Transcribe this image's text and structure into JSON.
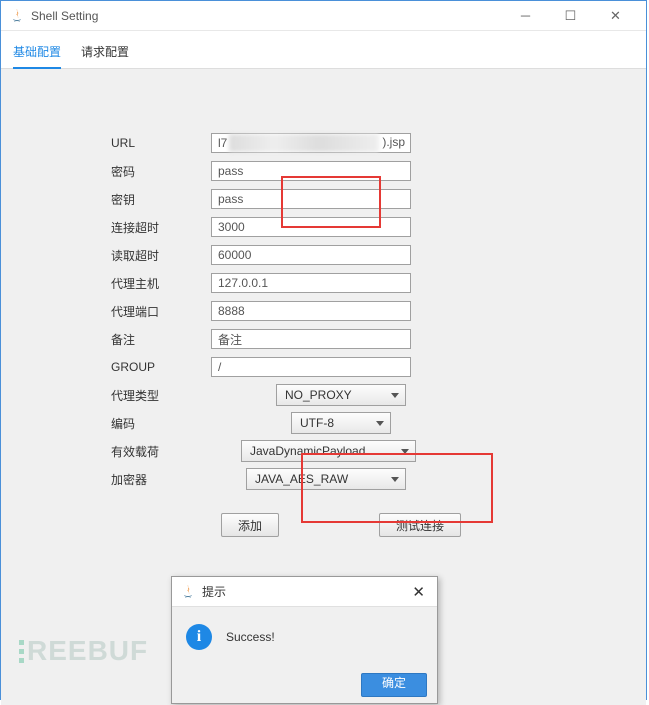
{
  "title": "Shell Setting",
  "tabs": {
    "basic": "基础配置",
    "request": "请求配置"
  },
  "labels": {
    "url": "URL",
    "password": "密码",
    "key": "密钥",
    "connTimeout": "连接超时",
    "readTimeout": "读取超时",
    "proxyHost": "代理主机",
    "proxyPort": "代理端口",
    "remark": "备注",
    "group": "GROUP",
    "proxyType": "代理类型",
    "encoding": "编码",
    "payload": "有效载荷",
    "encryptor": "加密器"
  },
  "values": {
    "url_prefix": "l7",
    "url_suffix": ").jsp",
    "password": "pass",
    "key": "pass",
    "connTimeout": "3000",
    "readTimeout": "60000",
    "proxyHost": "127.0.0.1",
    "proxyPort": "8888",
    "remark": "备注",
    "group": "/",
    "proxyType": "NO_PROXY",
    "encoding": "UTF-8",
    "payload": "JavaDynamicPayload",
    "encryptor": "JAVA_AES_RAW"
  },
  "buttons": {
    "add": "添加",
    "test": "测试连接"
  },
  "dialog": {
    "title": "提示",
    "message": "Success!",
    "ok": "确定"
  },
  "watermark": "REEBUF"
}
